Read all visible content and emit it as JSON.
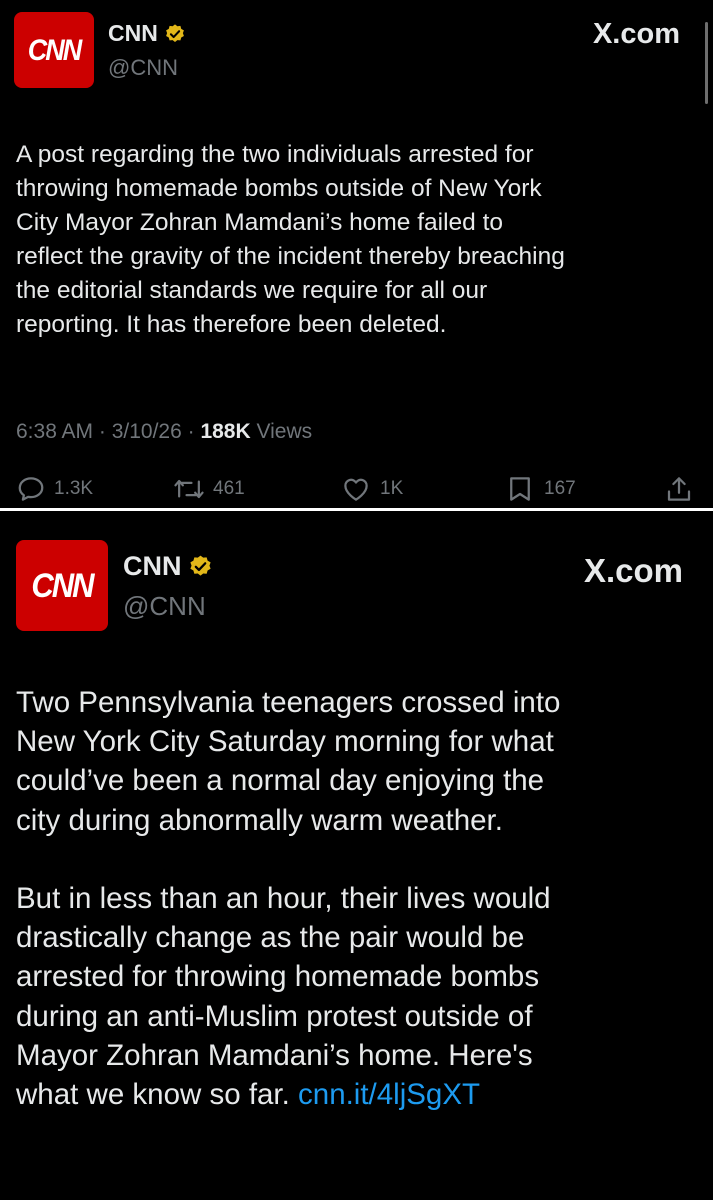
{
  "posts": [
    {
      "logo_text": "CNN",
      "name": "CNN",
      "handle": "@CNN",
      "source": "X.com",
      "text": "A post regarding the two individuals arrested for\nthrowing homemade bombs outside of New York\nCity Mayor Zohran Mamdani’s home failed to\nreflect the gravity of the incident thereby breaching\nthe editorial standards we require for all our\nreporting. It has therefore been deleted.",
      "time": "6:38 AM · 3/10/26 · ",
      "views_count": "188K",
      "views_label": " Views",
      "replies": "1.3K",
      "reposts": "461",
      "likes": "1K",
      "bookmarks": "167"
    },
    {
      "logo_text": "CNN",
      "name": "CNN",
      "handle": "@CNN",
      "source": "X.com",
      "text": "Two Pennsylvania teenagers crossed into\nNew York City Saturday morning for what\ncould’ve been a normal day enjoying the\ncity during abnormally warm weather.\n\nBut in less than an hour, their lives would\ndrastically change as the pair would be\narrested for throwing homemade bombs\nduring an anti-Muslim protest outside of\nMayor Zohran Mamdani’s home. Here's\nwhat we know so far. ",
      "link": "cnn.it/4ljSgXT"
    }
  ],
  "colors": {
    "brand_red": "#cc0000",
    "verified_gold": "#e2b719",
    "link_blue": "#1d9bf0",
    "muted": "#71767b"
  },
  "icons": [
    "reply-icon",
    "repost-icon",
    "like-icon",
    "bookmark-icon",
    "share-icon",
    "verified-badge-icon"
  ]
}
